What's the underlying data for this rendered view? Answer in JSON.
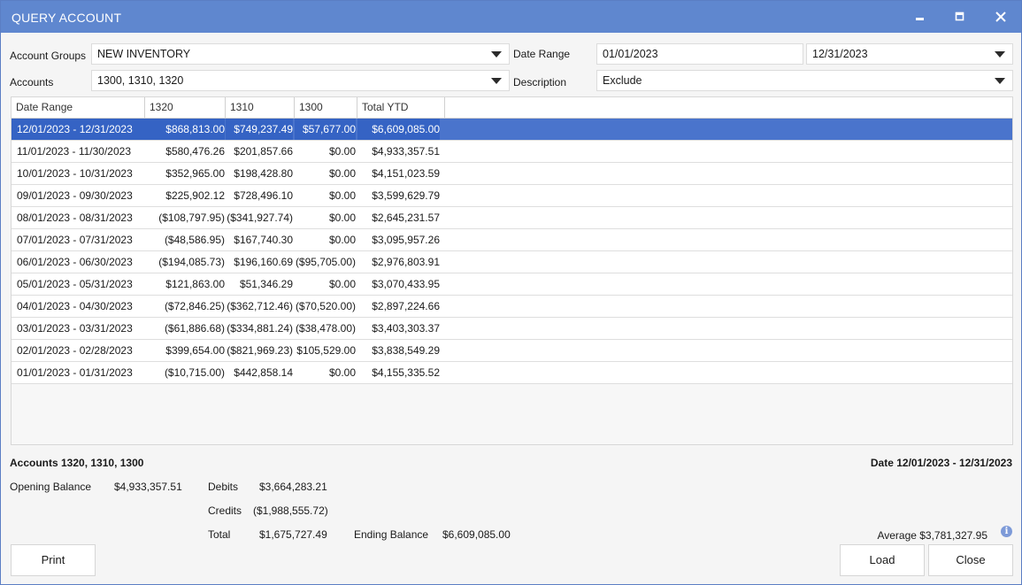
{
  "window": {
    "title": "QUERY ACCOUNT",
    "accent": "#5f87cf"
  },
  "filters": {
    "account_groups_label": "Account Groups",
    "account_groups_value": "NEW INVENTORY",
    "accounts_label": "Accounts",
    "accounts_value": "1300, 1310, 1320",
    "date_range_label": "Date Range",
    "date_from": "01/01/2023",
    "date_to": "12/31/2023",
    "description_label": "Description",
    "description_value": "Exclude"
  },
  "grid": {
    "columns": [
      "Date Range",
      "1320",
      "1310",
      "1300",
      "Total YTD"
    ],
    "rows": [
      [
        "12/01/2023 - 12/31/2023",
        "$868,813.00",
        "$749,237.49",
        "$57,677.00",
        "$6,609,085.00"
      ],
      [
        "11/01/2023 - 11/30/2023",
        "$580,476.26",
        "$201,857.66",
        "$0.00",
        "$4,933,357.51"
      ],
      [
        "10/01/2023 - 10/31/2023",
        "$352,965.00",
        "$198,428.80",
        "$0.00",
        "$4,151,023.59"
      ],
      [
        "09/01/2023 - 09/30/2023",
        "$225,902.12",
        "$728,496.10",
        "$0.00",
        "$3,599,629.79"
      ],
      [
        "08/01/2023 - 08/31/2023",
        "($108,797.95)",
        "($341,927.74)",
        "$0.00",
        "$2,645,231.57"
      ],
      [
        "07/01/2023 - 07/31/2023",
        "($48,586.95)",
        "$167,740.30",
        "$0.00",
        "$3,095,957.26"
      ],
      [
        "06/01/2023 - 06/30/2023",
        "($194,085.73)",
        "$196,160.69",
        "($95,705.00)",
        "$2,976,803.91"
      ],
      [
        "05/01/2023 - 05/31/2023",
        "$121,863.00",
        "$51,346.29",
        "$0.00",
        "$3,070,433.95"
      ],
      [
        "04/01/2023 - 04/30/2023",
        "($72,846.25)",
        "($362,712.46)",
        "($70,520.00)",
        "$2,897,224.66"
      ],
      [
        "03/01/2023 - 03/31/2023",
        "($61,886.68)",
        "($334,881.24)",
        "($38,478.00)",
        "$3,403,303.37"
      ],
      [
        "02/01/2023 - 02/28/2023",
        "$399,654.00",
        "($821,969.23)",
        "$105,529.00",
        "$3,838,549.29"
      ],
      [
        "01/01/2023 - 01/31/2023",
        "($10,715.00)",
        "$442,858.14",
        "$0.00",
        "$4,155,335.52"
      ]
    ],
    "selected_color": "#4a74cc"
  },
  "summary": {
    "accounts_title": "Accounts 1320, 1310, 1300",
    "date_title": "Date 12/01/2023 - 12/31/2023",
    "opening_balance_label": "Opening Balance",
    "opening_balance_value": "$4,933,357.51",
    "debits_label": "Debits",
    "debits_value": "$3,664,283.21",
    "credits_label": "Credits",
    "credits_value": "($1,988,555.72)",
    "total_label": "Total",
    "total_value": "$1,675,727.49",
    "ending_balance_label": "Ending Balance",
    "ending_balance_value": "$6,609,085.00",
    "average_text": "Average $3,781,327.95"
  },
  "buttons": {
    "print": "Print",
    "load": "Load",
    "close": "Close"
  },
  "icons": {
    "minimize": "minimize-icon",
    "maximize": "maximize-icon",
    "close": "close-icon",
    "dropdown": "chevron-down-icon",
    "info": "info-icon",
    "info_glyph": "i"
  }
}
